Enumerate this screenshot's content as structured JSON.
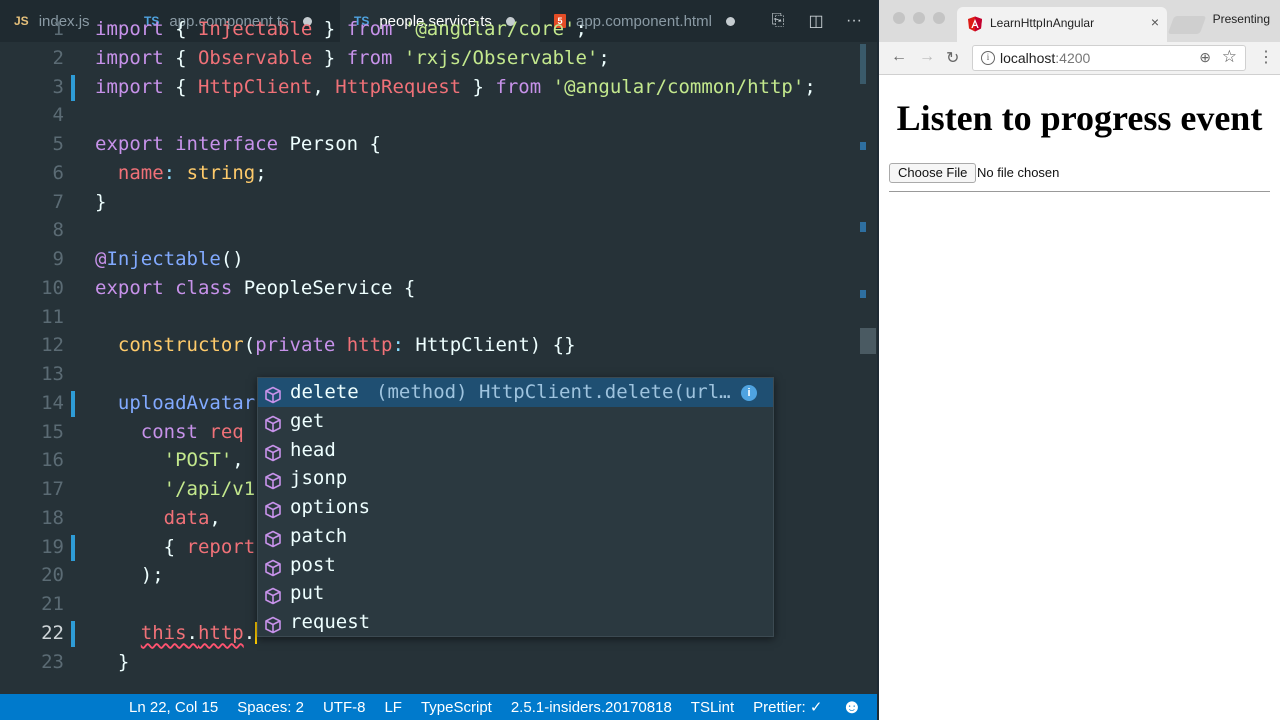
{
  "editor": {
    "tabs": [
      {
        "icon": "JS",
        "icon_kind": "javascript-file-icon",
        "label": "index.js",
        "dirty": false,
        "active": false
      },
      {
        "icon": "TS",
        "icon_kind": "typescript-file-icon",
        "label": "app.component.ts",
        "dirty": true,
        "active": false
      },
      {
        "icon": "TS",
        "icon_kind": "typescript-file-icon",
        "label": "people.service.ts",
        "dirty": true,
        "active": true
      },
      {
        "icon": "5",
        "icon_kind": "html-file-icon",
        "label": "app.component.html",
        "dirty": true,
        "active": false
      }
    ],
    "actions": [
      {
        "name": "open-changes-icon",
        "glyph": "⎘"
      },
      {
        "name": "split-editor-icon",
        "glyph": "◫"
      },
      {
        "name": "more-actions-icon",
        "glyph": "···"
      }
    ],
    "current_line": "22",
    "lines": [
      {
        "n": "1",
        "tokens": [
          [
            "kw",
            "import"
          ],
          [
            "pl",
            " { "
          ],
          [
            "id",
            "Injectable"
          ],
          [
            "pl",
            " } "
          ],
          [
            "kw",
            "from"
          ],
          [
            "pl",
            " "
          ],
          [
            "str",
            "'@angular/core'"
          ],
          [
            "pl",
            ";"
          ]
        ]
      },
      {
        "n": "2",
        "tokens": [
          [
            "kw",
            "import"
          ],
          [
            "pl",
            " { "
          ],
          [
            "id",
            "Observable"
          ],
          [
            "pl",
            " } "
          ],
          [
            "kw",
            "from"
          ],
          [
            "pl",
            " "
          ],
          [
            "str",
            "'rxjs/Observable'"
          ],
          [
            "pl",
            ";"
          ]
        ]
      },
      {
        "n": "3",
        "mark": true,
        "tokens": [
          [
            "kw",
            "import"
          ],
          [
            "pl",
            " { "
          ],
          [
            "id",
            "HttpClient"
          ],
          [
            "pl",
            ", "
          ],
          [
            "id",
            "HttpRequest"
          ],
          [
            "pl",
            " } "
          ],
          [
            "kw",
            "from"
          ],
          [
            "pl",
            " "
          ],
          [
            "str",
            "'@angular/common/http'"
          ],
          [
            "pl",
            ";"
          ]
        ]
      },
      {
        "n": "4",
        "tokens": []
      },
      {
        "n": "5",
        "tokens": [
          [
            "kw",
            "export"
          ],
          [
            "pl",
            " "
          ],
          [
            "kw",
            "interface"
          ],
          [
            "pl",
            " Person {"
          ]
        ]
      },
      {
        "n": "6",
        "tokens": [
          [
            "pl",
            "  "
          ],
          [
            "id",
            "name"
          ],
          [
            "pn",
            ":"
          ],
          [
            "pl",
            " "
          ],
          [
            "ty",
            "string"
          ],
          [
            "pl",
            ";"
          ]
        ]
      },
      {
        "n": "7",
        "tokens": [
          [
            "pl",
            "}"
          ]
        ]
      },
      {
        "n": "8",
        "tokens": []
      },
      {
        "n": "9",
        "tokens": [
          [
            "kw",
            "@"
          ],
          [
            "fn",
            "Injectable"
          ],
          [
            "pl",
            "()"
          ]
        ]
      },
      {
        "n": "10",
        "tokens": [
          [
            "kw",
            "export"
          ],
          [
            "pl",
            " "
          ],
          [
            "kw",
            "class"
          ],
          [
            "pl",
            " PeopleService {"
          ]
        ]
      },
      {
        "n": "11",
        "tokens": []
      },
      {
        "n": "12",
        "tokens": [
          [
            "pl",
            "  "
          ],
          [
            "ty",
            "constructor"
          ],
          [
            "pl",
            "("
          ],
          [
            "kw",
            "private"
          ],
          [
            "pl",
            " "
          ],
          [
            "id",
            "http"
          ],
          [
            "pn",
            ":"
          ],
          [
            "pl",
            " HttpClient) {}"
          ]
        ]
      },
      {
        "n": "13",
        "tokens": []
      },
      {
        "n": "14",
        "mark": true,
        "tokens": [
          [
            "pl",
            "  "
          ],
          [
            "fn",
            "uploadAvatar"
          ]
        ]
      },
      {
        "n": "15",
        "tokens": [
          [
            "pl",
            "    "
          ],
          [
            "kw",
            "const"
          ],
          [
            "pl",
            " "
          ],
          [
            "id",
            "req"
          ]
        ]
      },
      {
        "n": "16",
        "tokens": [
          [
            "pl",
            "      "
          ],
          [
            "str",
            "'POST'"
          ],
          [
            "pl",
            ","
          ]
        ]
      },
      {
        "n": "17",
        "tokens": [
          [
            "pl",
            "      "
          ],
          [
            "str",
            "'/api/v1"
          ]
        ]
      },
      {
        "n": "18",
        "tokens": [
          [
            "pl",
            "      "
          ],
          [
            "id",
            "data"
          ],
          [
            "pl",
            ","
          ]
        ]
      },
      {
        "n": "19",
        "mark": true,
        "tokens": [
          [
            "pl",
            "      { "
          ],
          [
            "id",
            "report"
          ]
        ]
      },
      {
        "n": "20",
        "tokens": [
          [
            "pl",
            "    );"
          ]
        ]
      },
      {
        "n": "21",
        "tokens": []
      },
      {
        "n": "22",
        "mark": true,
        "tokens": [
          [
            "pl",
            "    "
          ],
          [
            "sq",
            "this"
          ],
          [
            "sqp",
            "."
          ],
          [
            "sq",
            "http"
          ],
          [
            "pl",
            "."
          ],
          [
            "cursor",
            ""
          ]
        ]
      },
      {
        "n": "23",
        "tokens": [
          [
            "pl",
            "  }"
          ]
        ]
      }
    ],
    "suggestions": {
      "items": [
        {
          "label": "delete",
          "detail": "(method) HttpClient.delete(url…",
          "selected": true
        },
        {
          "label": "get"
        },
        {
          "label": "head"
        },
        {
          "label": "jsonp"
        },
        {
          "label": "options"
        },
        {
          "label": "patch"
        },
        {
          "label": "post"
        },
        {
          "label": "put"
        },
        {
          "label": "request"
        }
      ],
      "info_glyph": "i"
    },
    "status": {
      "position": "Ln 22, Col 15",
      "indent": "Spaces: 2",
      "encoding": "UTF-8",
      "eol": "LF",
      "language": "TypeScript",
      "ts_version": "2.5.1-insiders.20170818",
      "linter": "TSLint",
      "formatter": "Prettier: ✓",
      "feedback": "☻"
    }
  },
  "browser": {
    "tab_title": "LearnHttpInAngular",
    "tab_close": "×",
    "presenting": "Presenting",
    "address_host": "localhost",
    "address_port": ":4200",
    "info_glyph": "i",
    "zoom_glyph": "⊕",
    "star_glyph": "☆",
    "back_glyph": "←",
    "forward_glyph": "→",
    "reload_glyph": "↻",
    "menu_glyph": "⋮",
    "heading": "Listen to progress event",
    "file_button": "Choose File",
    "file_status": "No file chosen"
  },
  "colors": {
    "editor_bg": "#263238",
    "status_bar": "#007acc",
    "selection": "#1f4f72",
    "angular_red": "#dd1b16"
  }
}
